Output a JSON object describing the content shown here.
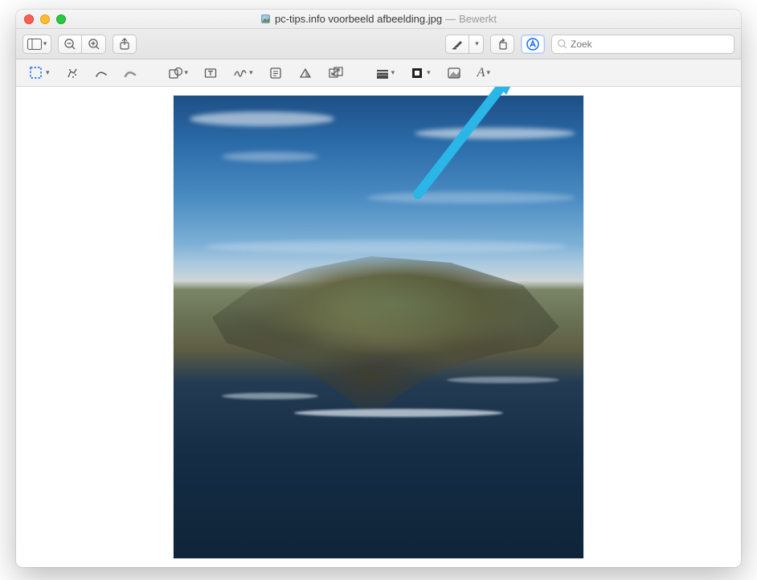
{
  "titlebar": {
    "filename": "pc-tips.info voorbeeld afbeelding.jpg",
    "status_separator": "—",
    "status": "Bewerkt"
  },
  "toolbar": {
    "search_placeholder": "Zoek"
  },
  "markupbar": {
    "text_style_label": "A"
  },
  "annotation": {
    "arrow_color": "#2bb6e8"
  }
}
